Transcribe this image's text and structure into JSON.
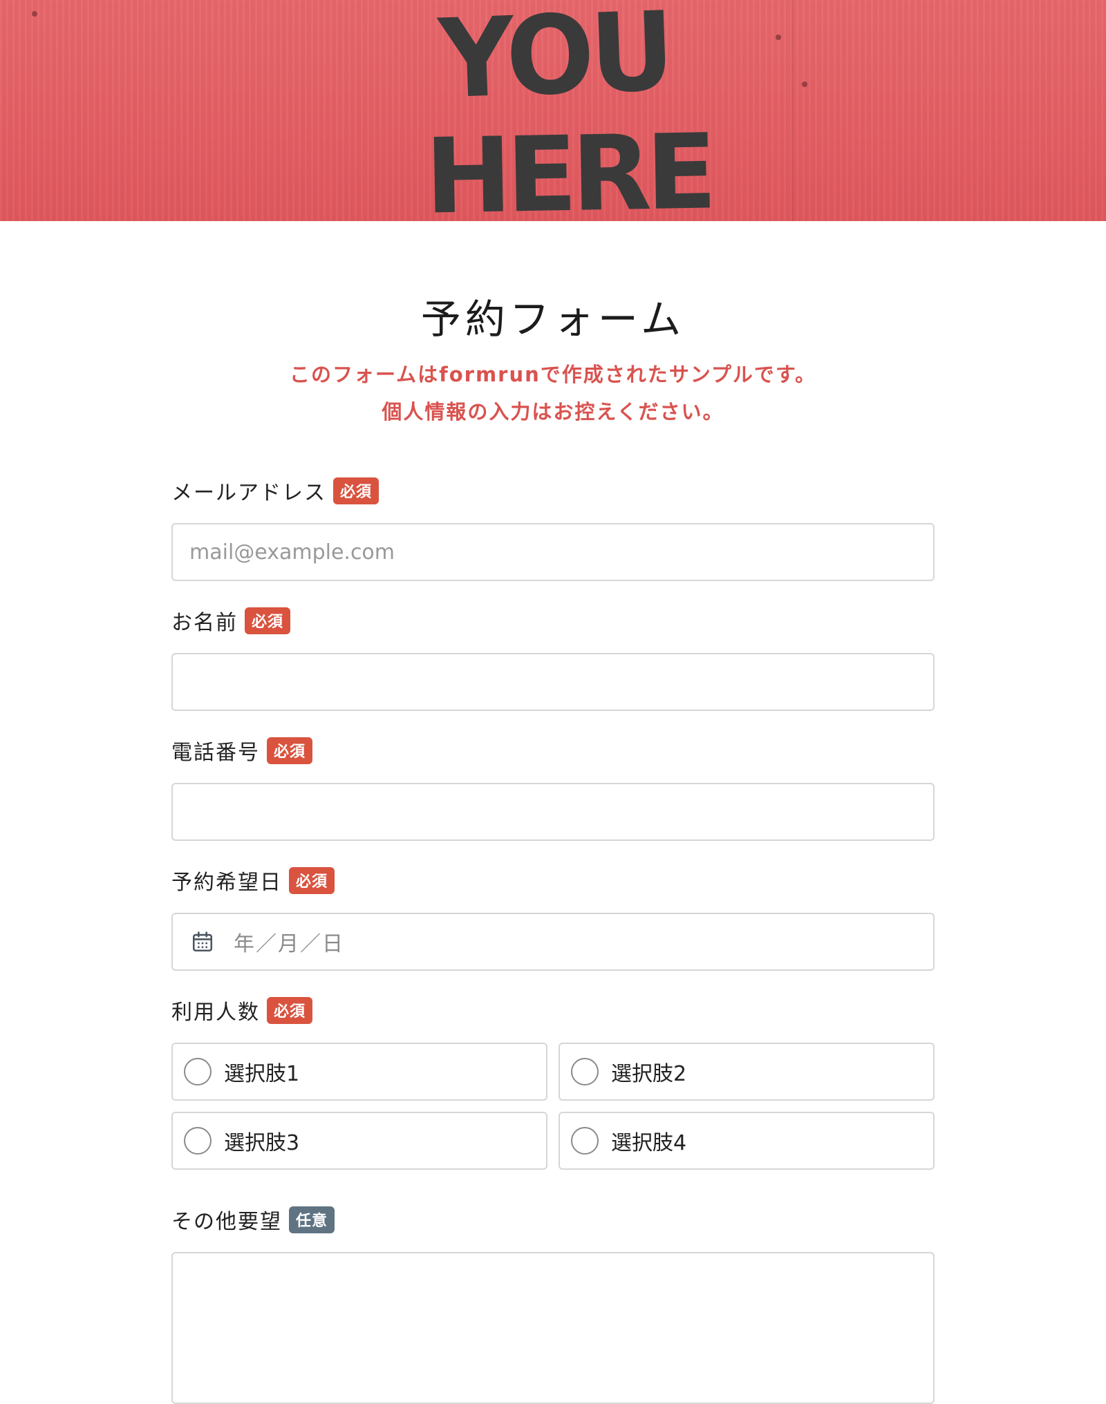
{
  "header": {
    "image_text_line1": "YOU",
    "image_text_line2": "HERE"
  },
  "form": {
    "title": "予約フォーム",
    "notice_line1": "このフォームはformrunで作成されたサンプルです。",
    "notice_line2": "個人情報の入力はお控えください。"
  },
  "badges": {
    "required": "必須",
    "optional": "任意"
  },
  "fields": {
    "email": {
      "label": "メールアドレス",
      "placeholder": "mail@example.com"
    },
    "name": {
      "label": "お名前"
    },
    "phone": {
      "label": "電話番号"
    },
    "date": {
      "label": "予約希望日",
      "placeholder": "年／月／日"
    },
    "people": {
      "label": "利用人数",
      "options": [
        "選択肢1",
        "選択肢2",
        "選択肢3",
        "選択肢4"
      ]
    },
    "other": {
      "label": "その他要望"
    }
  },
  "colors": {
    "required_badge": "#d9533f",
    "optional_badge": "#5f7382",
    "notice_text": "#d9534f",
    "header_background": "#e35e63"
  }
}
